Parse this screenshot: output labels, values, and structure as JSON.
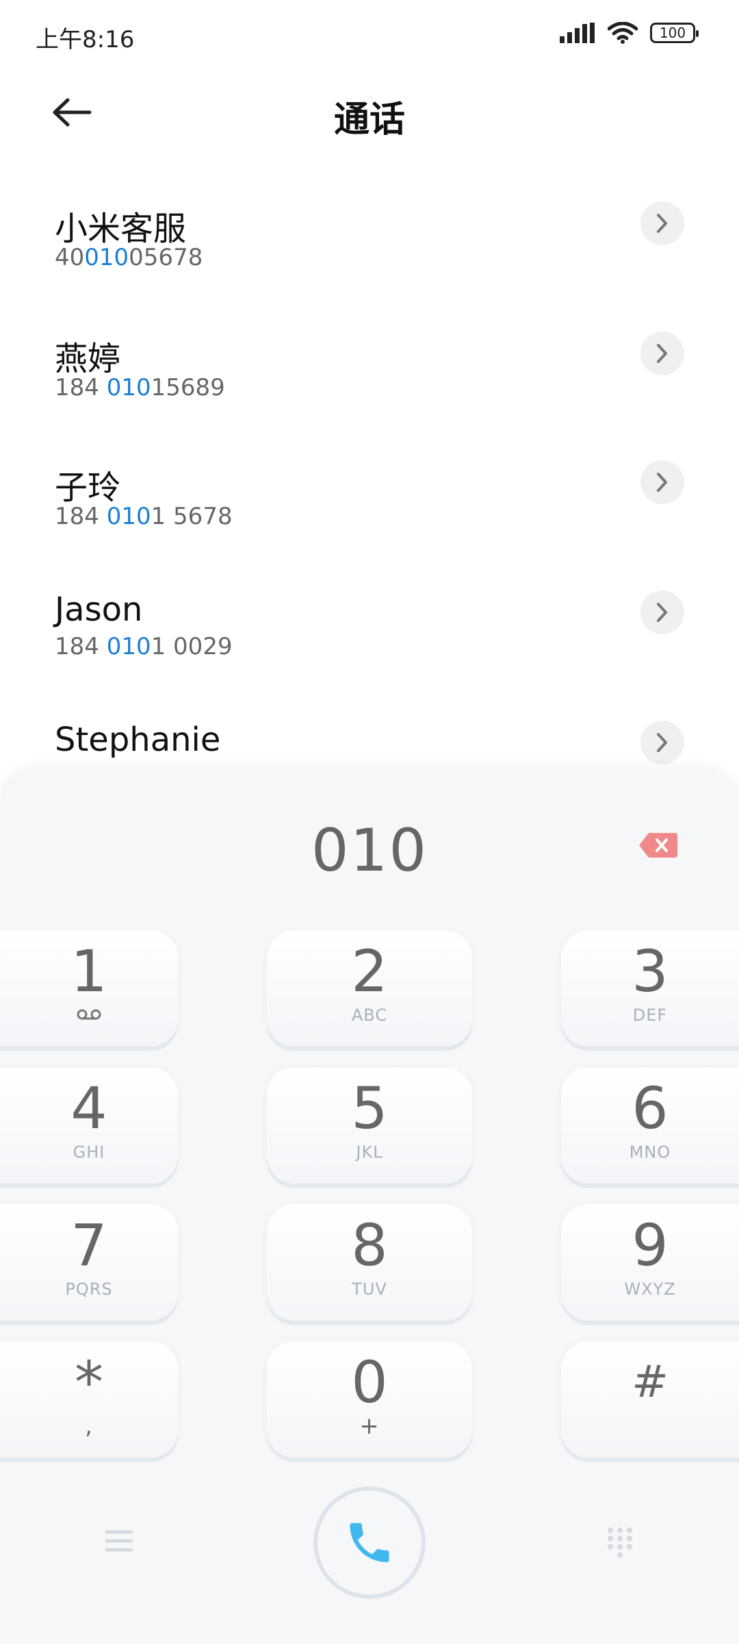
{
  "status_bar": {
    "time": "上午8:16",
    "battery": "100",
    "icons": [
      "signal-icon",
      "wifi-icon",
      "battery-icon"
    ]
  },
  "header": {
    "title": "通话",
    "back_icon": "arrow-left-icon"
  },
  "contacts": [
    {
      "name": "小米客服",
      "number_pre": "40",
      "number_hl": "010",
      "number_post": "05678"
    },
    {
      "name": "燕婷",
      "number_pre": "184 ",
      "number_hl": "010",
      "number_post": "15689"
    },
    {
      "name": "子玲",
      "number_pre": "184 ",
      "number_hl": "010",
      "number_post": "1 5678"
    },
    {
      "name": "Jason",
      "number_pre": "184 ",
      "number_hl": "010",
      "number_post": "1 0029"
    },
    {
      "name": "Stephanie",
      "number_pre": "",
      "number_hl": "",
      "number_post": ""
    }
  ],
  "dialer": {
    "input": "010",
    "keys": [
      {
        "digit": "1",
        "letters": "ᴼᴼ"
      },
      {
        "digit": "2",
        "letters": "ABC"
      },
      {
        "digit": "3",
        "letters": "DEF"
      },
      {
        "digit": "4",
        "letters": "GHI"
      },
      {
        "digit": "5",
        "letters": "JKL"
      },
      {
        "digit": "6",
        "letters": "MNO"
      },
      {
        "digit": "7",
        "letters": "PQRS"
      },
      {
        "digit": "8",
        "letters": "TUV"
      },
      {
        "digit": "9",
        "letters": "WXYZ"
      },
      {
        "digit": "*",
        "letters": ","
      },
      {
        "digit": "0",
        "letters": "+"
      },
      {
        "digit": "#",
        "letters": ""
      }
    ]
  },
  "colors": {
    "highlight": "#1a7fd4",
    "call_icon": "#3fb8f0",
    "delete_icon": "#f08a8a"
  }
}
